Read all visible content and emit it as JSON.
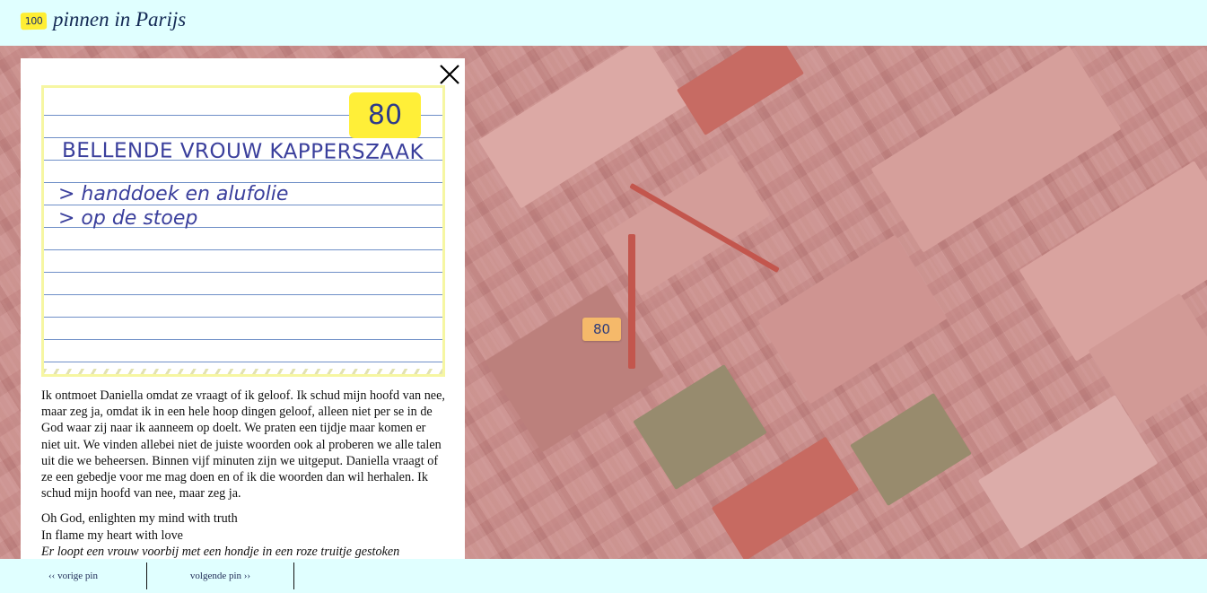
{
  "header": {
    "badge": "100",
    "title": "pinnen in Parijs"
  },
  "map": {
    "pin_label": "80"
  },
  "panel": {
    "close_icon": "close-x-icon",
    "note": {
      "number": "80",
      "heading": "BELLENDE VROUW KAPPERSZAAK",
      "lines": [
        "> handdoek en alufolie",
        "> op de stoep"
      ]
    },
    "story": "Ik ontmoet Daniella omdat ze vraagt of ik geloof. Ik schud mijn hoofd van nee, maar zeg ja, omdat ik in een hele hoop dingen geloof, alleen niet per se in de God waar zij naar ik aanneem op doelt. We praten een tijdje maar komen er niet uit. We vinden allebei niet de juiste woorden ook al proberen we alle talen uit die we beheersen. Binnen vijf minuten zijn we uitgeput. Daniella vraagt of ze een gebedje voor me mag doen en of ik die woorden dan wil herhalen. Ik schud mijn hoofd van nee, maar zeg ja.",
    "poem": [
      "Oh God, enlighten my mind with truth",
      "In flame my heart with love"
    ],
    "poem_italic": "Er loopt een vrouw voorbij met een hondje in een roze truitje gestoken"
  },
  "footer": {
    "prev_label": "‹‹ vorige pin",
    "next_label": "volgende pin ››"
  },
  "colors": {
    "background": "#e0ffff",
    "badge_yellow": "#ffee33",
    "pin_orange": "#f5b96a",
    "title_blue": "#142a55"
  }
}
